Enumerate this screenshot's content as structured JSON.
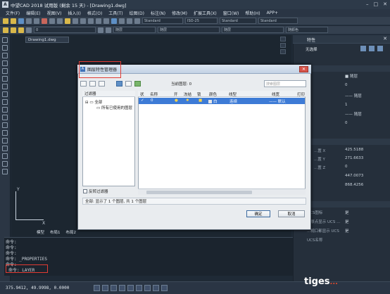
{
  "window": {
    "title": "中望CAD 2018 试用版 (剩余 15 天) - [Drawing1.dwg]",
    "logo": "A"
  },
  "menu": [
    "文件(F)",
    "编辑(E)",
    "视图(V)",
    "插入(I)",
    "格式(O)",
    "工具(T)",
    "绘图(D)",
    "标注(N)",
    "修改(M)",
    "扩展工具(X)",
    "窗口(W)",
    "帮助(H)",
    "APP+"
  ],
  "toolbar": {
    "textstyle": "Standard",
    "dimstyle": "ISO-25",
    "tablestyle": "Standard",
    "mleaderstyle": "Standard",
    "layer_value": "0",
    "linetype_1": "随层",
    "linetype_2": "随层",
    "lineweight": "随层",
    "color_by": "随颜色"
  },
  "document": {
    "tab_label": "Drawing1.dwg",
    "ucs_y": "Y",
    "ucs_x": "X",
    "model_tabs": [
      "模型",
      "布局1",
      "布局2"
    ]
  },
  "command": {
    "lines": [
      "命令:",
      "命令:",
      "命令:",
      "命令: _PROPERTIES",
      "命令:"
    ],
    "current": "命令: LAYER"
  },
  "status": {
    "coords": "375.9412, 49.9998, 0.0000",
    "watermark": "tiges",
    "watermark_suffix": "..."
  },
  "properties": {
    "title": "特性",
    "selection": "无选择",
    "rows": [
      {
        "k": "",
        "v": "■ 随层"
      },
      {
        "k": "",
        "v": "0"
      },
      {
        "k": "",
        "v": "—— 随层"
      },
      {
        "k": "",
        "v": "1"
      },
      {
        "k": "",
        "v": "—— 随层"
      },
      {
        "k": "",
        "v": "0"
      }
    ],
    "geo_rows": [
      {
        "k": "...置 X",
        "v": "425.5188"
      },
      {
        "k": "...置 Y",
        "v": "271.6633"
      },
      {
        "k": "...置 Z",
        "v": "0"
      },
      {
        "k": "",
        "v": "447.0073"
      },
      {
        "k": "",
        "v": "868.4256"
      }
    ],
    "misc_rows": [
      {
        "k": "UCS图标",
        "v": "是"
      },
      {
        "k": "...原点显示 UCS ...",
        "v": "是"
      },
      {
        "k": "...视口都显示 UCS",
        "v": "是"
      },
      {
        "k": "UCS名称",
        "v": ""
      }
    ]
  },
  "dialog": {
    "title": "图层特性管理器",
    "icon": "A",
    "current_layer_label": "当前图层: 0",
    "search_placeholder": "搜索图层",
    "filters_header": "过滤器",
    "filter_all": "全部",
    "filter_used": "所有已使用的图层",
    "invert_filter": "反转过滤器",
    "columns": [
      "状",
      "名称",
      "开",
      "冻结",
      "锁",
      "颜色",
      "线型",
      "线宽",
      "打印"
    ],
    "layer": {
      "status": "✓",
      "name": "0",
      "color": "白",
      "linetype": "连续",
      "lineweight": "默认"
    },
    "status_text": "全部: 显示了 1 个图层, 共 1 个图层",
    "ok_label": "确定",
    "cancel_label": "取消"
  },
  "colors": {
    "accent": "#3d7bd6",
    "highlight": "#e23b33",
    "background": "#1f2a36"
  }
}
